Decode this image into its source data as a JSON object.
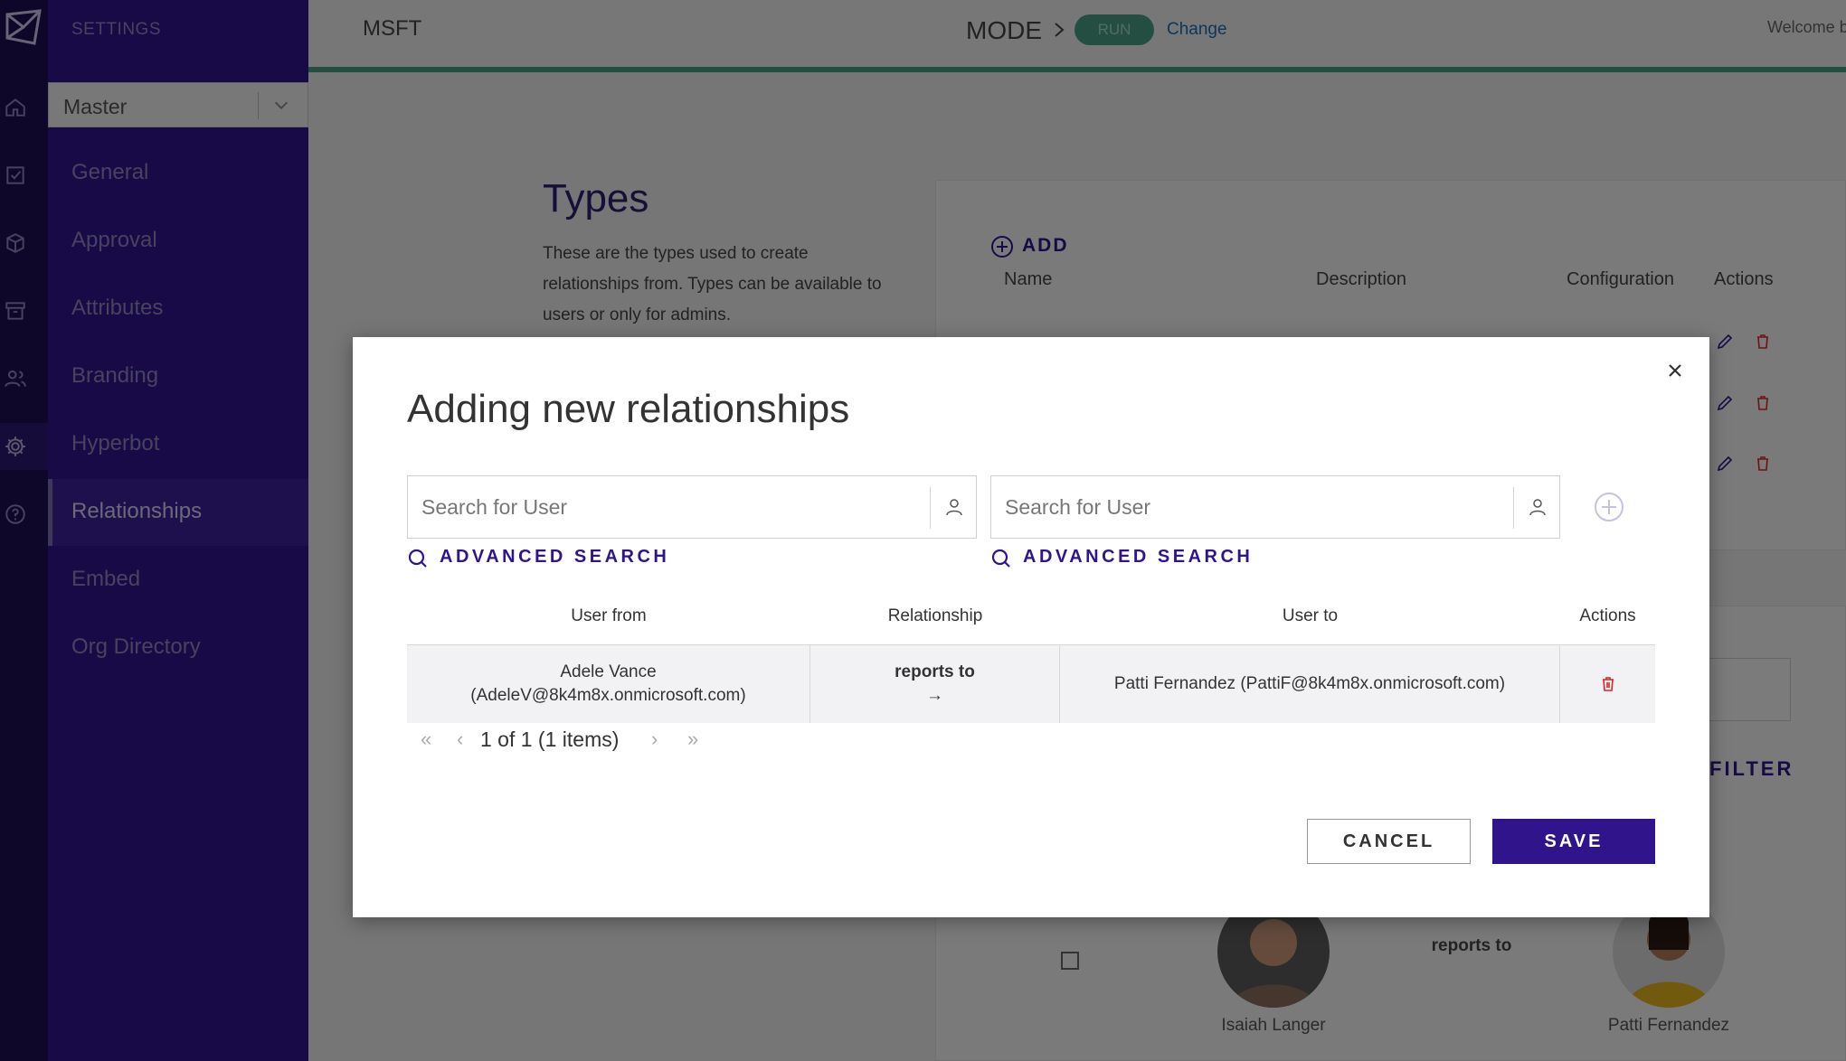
{
  "app": {
    "settings_title": "SETTINGS",
    "environment_select": "Master"
  },
  "sidebar": {
    "items": [
      {
        "label": "General"
      },
      {
        "label": "Approval"
      },
      {
        "label": "Attributes"
      },
      {
        "label": "Branding"
      },
      {
        "label": "Hyperbot"
      },
      {
        "label": "Relationships",
        "active": true
      },
      {
        "label": "Embed"
      },
      {
        "label": "Org Directory"
      }
    ]
  },
  "rail_icons": [
    "home-icon",
    "checklist-icon",
    "cube-icon",
    "archive-icon",
    "users-icon",
    "gear-icon",
    "help-icon"
  ],
  "topbar": {
    "tenant": "MSFT",
    "mode_label": "MODE",
    "mode_value": "RUN",
    "change_link": "Change",
    "welcome": "Welcome b"
  },
  "types_section": {
    "title": "Types",
    "description": "These are the types used to create relationships from. Types can be available to users or only for admins.",
    "add_label": "ADD",
    "columns": [
      "Name",
      "Description",
      "Configuration",
      "Actions"
    ]
  },
  "background_relationships": {
    "filter_label": "FILTER",
    "row": {
      "user_from": "Isaiah Langer",
      "relationship": "reports to",
      "user_to": "Patti Fernandez"
    }
  },
  "modal": {
    "title": "Adding new relationships",
    "search_from_placeholder": "Search for User",
    "search_to_placeholder": "Search for User",
    "advanced_search_label": "ADVANCED SEARCH",
    "columns": {
      "user_from": "User from",
      "relationship": "Relationship",
      "user_to": "User to",
      "actions": "Actions"
    },
    "rows": [
      {
        "user_from_name": "Adele Vance",
        "user_from_email": "(AdeleV@8k4m8x.onmicrosoft.com)",
        "relationship": "reports to",
        "arrow": "→",
        "user_to": "Patti Fernandez (PattiF@8k4m8x.onmicrosoft.com)"
      }
    ],
    "pagination": {
      "first": "«",
      "prev": "‹",
      "status": "1 of 1 (1 items)",
      "next": "›",
      "last": "»"
    },
    "cancel_label": "CANCEL",
    "save_label": "SAVE"
  },
  "colors": {
    "brand": "#30148c",
    "run_badge": "#4a9c86",
    "delete": "#d9262a",
    "link": "#1b6db1"
  }
}
